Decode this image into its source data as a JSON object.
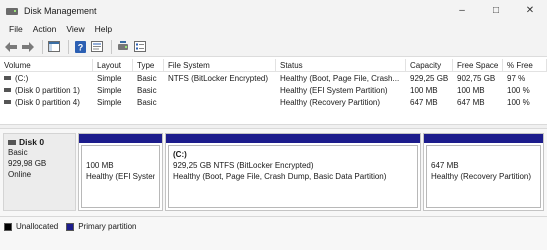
{
  "window": {
    "title": "Disk Management",
    "controls": [
      "–",
      "□",
      "✕"
    ]
  },
  "menu": [
    "File",
    "Action",
    "View",
    "Help"
  ],
  "toolbar": [
    "back-icon",
    "forward-icon",
    "console-tree-icon",
    "help-icon",
    "properties-icon",
    "disk-list-icon"
  ],
  "table": {
    "headers": [
      "Volume",
      "Layout",
      "Type",
      "File System",
      "Status",
      "Capacity",
      "Free Space",
      "% Free"
    ],
    "rows": [
      [
        "(C:)",
        "Simple",
        "Basic",
        "NTFS (BitLocker Encrypted)",
        "Healthy (Boot, Page File, Crash...",
        "929,25 GB",
        "902,75 GB",
        "97 %"
      ],
      [
        "(Disk 0 partition 1)",
        "Simple",
        "Basic",
        "",
        "Healthy (EFI System Partition)",
        "100 MB",
        "100 MB",
        "100 %"
      ],
      [
        "(Disk 0 partition 4)",
        "Simple",
        "Basic",
        "",
        "Healthy (Recovery Partition)",
        "647 MB",
        "647 MB",
        "100 %"
      ]
    ]
  },
  "disk": {
    "name": "Disk 0",
    "type": "Basic",
    "size": "929,98 GB",
    "status": "Online"
  },
  "partitions": [
    {
      "title": "",
      "line1": "100 MB",
      "line2": "Healthy (EFI System"
    },
    {
      "title": "(C:)",
      "line1": "929,25 GB NTFS (BitLocker Encrypted)",
      "line2": "Healthy (Boot, Page File, Crash Dump, Basic Data Partition)"
    },
    {
      "title": "",
      "line1": "647 MB",
      "line2": "Healthy (Recovery Partition)"
    }
  ],
  "legend": {
    "unallocated": "Unallocated",
    "primary": "Primary partition"
  },
  "colors": {
    "primary_partition": "#1c1c8c",
    "unallocated": "#000000"
  }
}
